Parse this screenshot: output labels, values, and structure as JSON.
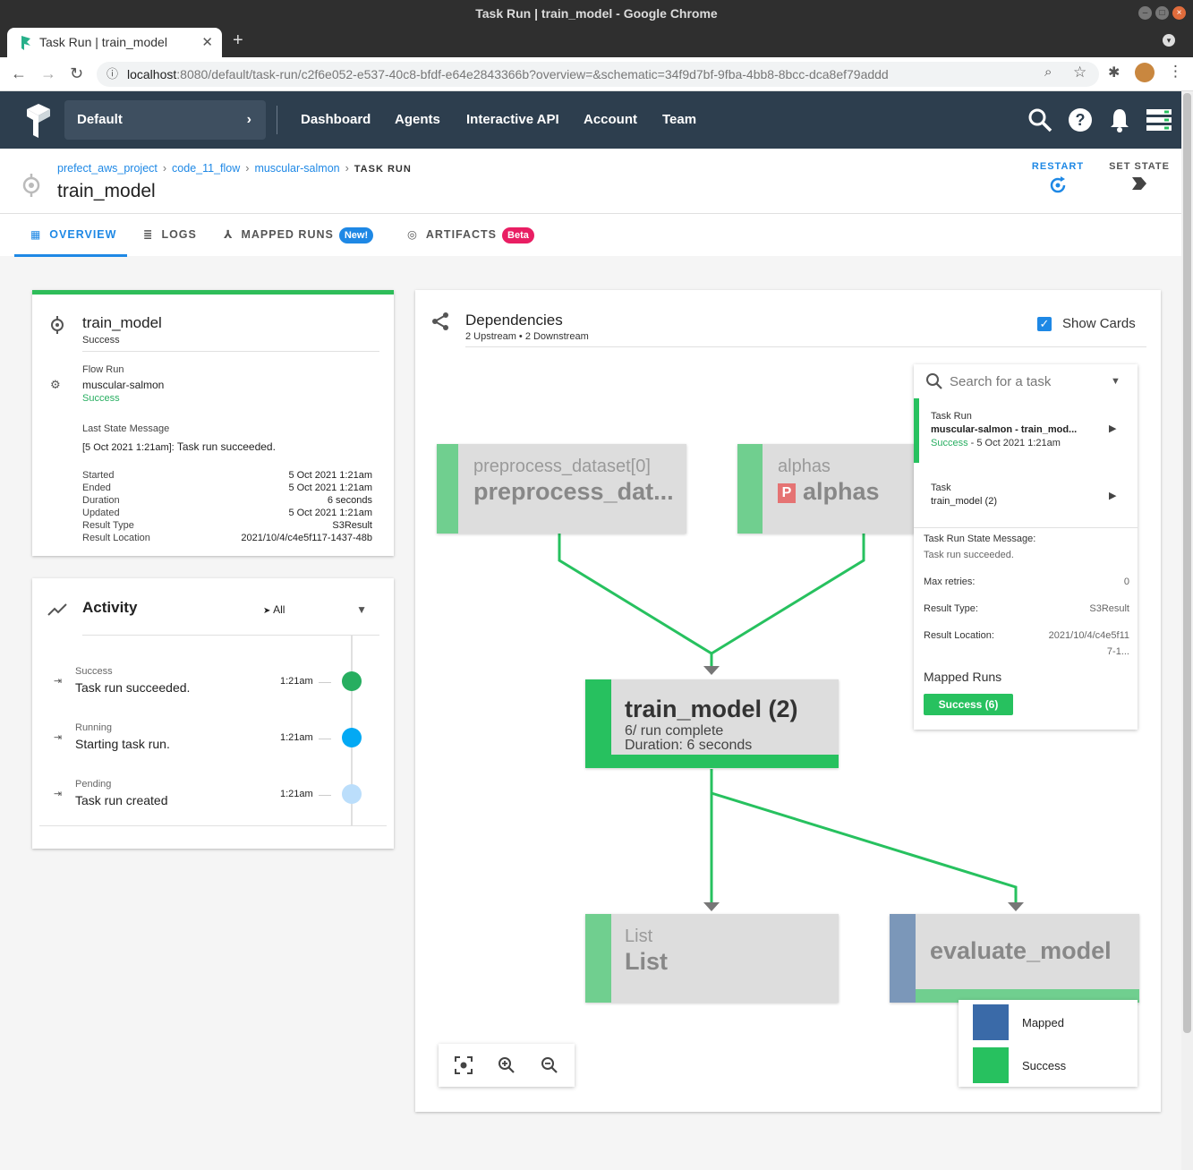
{
  "browser": {
    "window_title": "Task Run | train_model - Google Chrome",
    "tab_title": "Task Run | train_model",
    "url_host": "localhost",
    "url_rest": ":8080/default/task-run/c2f6e052-e537-40c8-bfdf-e64e2843366b?overview=&schematic=34f9d7bf-9fba-4bb8-8bcc-dca8ef79addd"
  },
  "header": {
    "team": "Default",
    "nav": [
      "Dashboard",
      "Agents",
      "Interactive API",
      "Account",
      "Team"
    ]
  },
  "breadcrumbs": {
    "project": "prefect_aws_project",
    "flow": "code_11_flow",
    "flow_run": "muscular-salmon",
    "current": "TASK RUN"
  },
  "page": {
    "title": "train_model",
    "restart": "RESTART",
    "set_state": "SET STATE"
  },
  "tabs": {
    "overview": "OVERVIEW",
    "logs": "LOGS",
    "mapped": "MAPPED RUNS",
    "mapped_badge": "New!",
    "artifacts": "ARTIFACTS",
    "artifacts_badge": "Beta"
  },
  "details": {
    "name": "train_model",
    "state": "Success",
    "flow_run_label": "Flow Run",
    "flow_run_name": "muscular-salmon",
    "flow_run_state": "Success",
    "last_msg_label": "Last State Message",
    "last_msg_time": "[5 Oct 2021 1:21am]:",
    "last_msg_text": "Task run succeeded.",
    "rows": [
      {
        "k": "Started",
        "v": "5 Oct 2021 1:21am"
      },
      {
        "k": "Ended",
        "v": "5 Oct 2021 1:21am"
      },
      {
        "k": "Duration",
        "v": "6 seconds"
      },
      {
        "k": "Updated",
        "v": "5 Oct 2021 1:21am"
      },
      {
        "k": "Result Type",
        "v": "S3Result"
      },
      {
        "k": "Result Location",
        "v": "2021/10/4/c4e5f117-1437-48b"
      }
    ]
  },
  "activity": {
    "title": "Activity",
    "filter": "All",
    "items": [
      {
        "state": "Success",
        "msg": "Task run succeeded.",
        "time": "1:21am",
        "color": "#27ae60"
      },
      {
        "state": "Running",
        "msg": "Starting task run.",
        "time": "1:21am",
        "color": "#03a9f4"
      },
      {
        "state": "Pending",
        "msg": "Task run created",
        "time": "1:21am",
        "color": "#bbdefb"
      }
    ]
  },
  "deps": {
    "title": "Dependencies",
    "subtitle": "2 Upstream • 2 Downstream",
    "show_cards": "Show Cards",
    "nodes": {
      "pre_sub": "preprocess_dataset[0]",
      "pre_big": "preprocess_dat...",
      "alphas_sub": "alphas",
      "alphas_badge": "P",
      "alphas_big": "alphas",
      "train_big": "train_model (2)",
      "train_line1": "6/ run complete",
      "train_line2": "Duration: 6 seconds",
      "list_sub": "List",
      "list_big": "List",
      "eval_big": "evaluate_model"
    },
    "colors": {
      "success": "#27c15f",
      "success_light": "#70cf8f",
      "mapped": "#3a6aa8"
    }
  },
  "side_panel": {
    "search_placeholder": "Search for a task",
    "task_run_label": "Task Run",
    "task_run_name": "muscular-salmon - train_mod...",
    "task_run_state": "Success",
    "task_run_time": "- 5 Oct 2021 1:21am",
    "task_label": "Task",
    "task_name": "train_model (2)",
    "state_msg_label": "Task Run State Message:",
    "state_msg": "Task run succeeded.",
    "max_retries_label": "Max retries:",
    "max_retries": "0",
    "result_type_label": "Result Type:",
    "result_type": "S3Result",
    "result_loc_label": "Result Location:",
    "result_loc_1": "2021/10/4/c4e5f11",
    "result_loc_2": "7-1...",
    "mapped_runs_label": "Mapped Runs",
    "mapped_btn": "Success (6)"
  },
  "legend": {
    "mapped": "Mapped",
    "success": "Success"
  }
}
